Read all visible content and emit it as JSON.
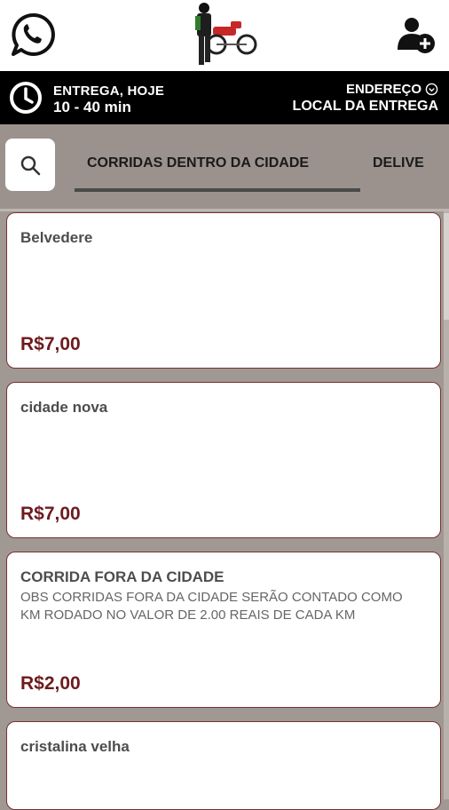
{
  "header": {
    "whatsapp_icon": "whatsapp-icon",
    "logo_icon": "motorcycle-courier-logo",
    "add_user_icon": "add-user-icon"
  },
  "info": {
    "delivery_label": "ENTREGA, HOJE",
    "delivery_time": "10 - 40 min",
    "address_label": "ENDEREÇO",
    "address_value": "LOCAL DA ENTREGA"
  },
  "tabs": {
    "items": [
      {
        "label": "CORRIDAS DENTRO DA CIDADE"
      },
      {
        "label": "DELIVE"
      }
    ]
  },
  "products": [
    {
      "title": "Belvedere",
      "description": "",
      "price": "R$7,00"
    },
    {
      "title": "cidade nova",
      "description": "",
      "price": "R$7,00"
    },
    {
      "title": "CORRIDA FORA DA CIDADE",
      "description": "OBS CORRIDAS FORA DA CIDADE SERÃO CONTADO COMO KM RODADO NO VALOR DE 2.00 REAIS DE CADA KM",
      "price": "R$2,00"
    },
    {
      "title": "cristalina velha",
      "description": "",
      "price": ""
    }
  ],
  "colors": {
    "accent_price": "#6e1b1e",
    "info_bar": "#000000",
    "page_background": "#a09893"
  }
}
